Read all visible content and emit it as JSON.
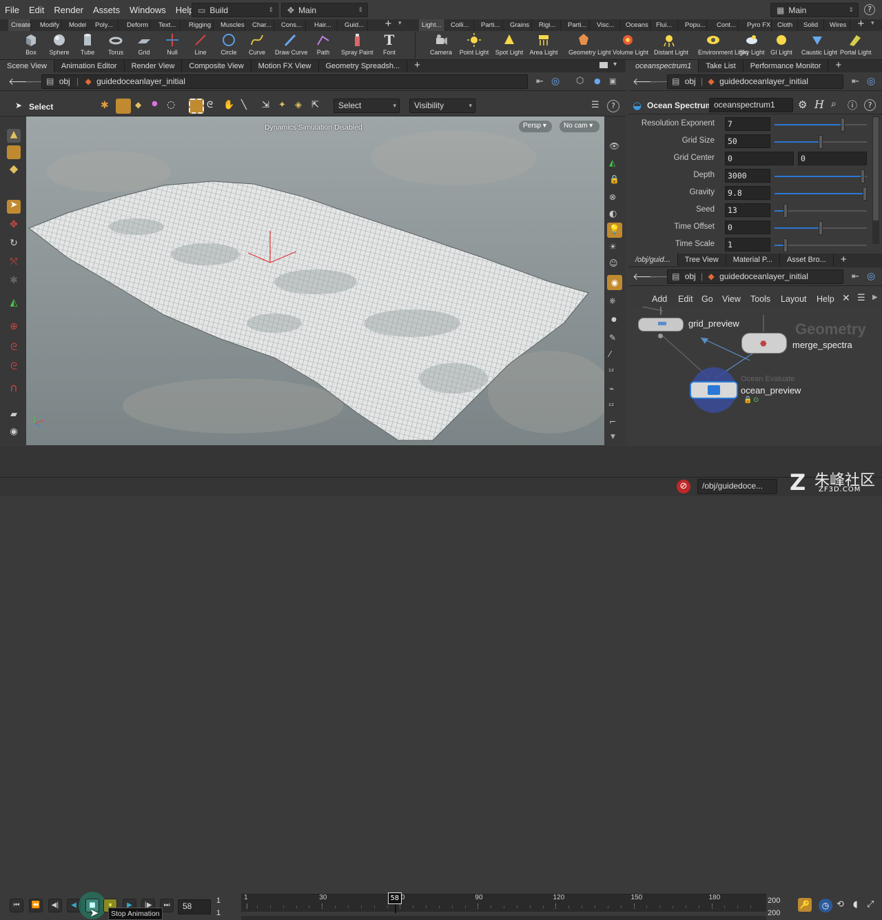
{
  "menu": [
    "File",
    "Edit",
    "Render",
    "Assets",
    "Windows",
    "Help"
  ],
  "desktop": {
    "build": "Build",
    "main": "Main",
    "top_right": "Main"
  },
  "shelf_tabs_left": [
    "Create",
    "Modify",
    "Model",
    "Poly...",
    "Deform",
    "Text...",
    "Rigging",
    "Muscles",
    "Char...",
    "Cons...",
    "Hair...",
    "Guid..."
  ],
  "shelf_tabs_right": [
    "Light...",
    "Colli...",
    "Parti...",
    "Grains",
    "Rigi...",
    "Parti...",
    "Visc...",
    "Oceans",
    "Flui...",
    "Popu...",
    "Cont...",
    "Pyro FX",
    "Cloth",
    "Solid",
    "Wires"
  ],
  "tools_left": [
    "Box",
    "Sphere",
    "Tube",
    "Torus",
    "Grid",
    "Null",
    "Line",
    "Circle",
    "Curve",
    "Draw Curve",
    "Path",
    "Spray Paint",
    "Font"
  ],
  "tools_right": [
    "Camera",
    "Point Light",
    "Spot Light",
    "Area Light",
    "Geometry Light",
    "Volume Light",
    "Distant Light",
    "Environment Light",
    "Sky Light",
    "GI Light",
    "Caustic Light",
    "Portal Light"
  ],
  "left_tabs": [
    "Scene View",
    "Animation Editor",
    "Render View",
    "Composite View",
    "Motion FX View",
    "Geometry Spreadsh..."
  ],
  "right_top_tabs": [
    "oceanspectrum1",
    "Take List",
    "Performance Monitor"
  ],
  "right_bottom_tabs": [
    "/obj/guid...",
    "Tree View",
    "Material P...",
    "Asset Bro..."
  ],
  "path": {
    "obj": "obj",
    "node": "guidedoceanlayer_initial"
  },
  "viewport_toolbar": {
    "select": "Select",
    "select_dd": "Select",
    "visibility": "Visibility"
  },
  "viewport": {
    "message": "Dynamics Simulation Disabled",
    "persp": "Persp",
    "cam": "No cam"
  },
  "parms": {
    "type_label": "Ocean Spectrum",
    "node_name": "oceanspectrum1",
    "rows": [
      {
        "label": "Resolution Exponent",
        "value": "7",
        "value2": "",
        "pct": 0.75
      },
      {
        "label": "Grid Size",
        "value": "50",
        "value2": "",
        "pct": 0.5
      },
      {
        "label": "Grid Center",
        "value": "0",
        "value2": "0",
        "pct": 0
      },
      {
        "label": "Depth",
        "value": "3000",
        "value2": "",
        "pct": 0.98
      },
      {
        "label": "Gravity",
        "value": "9.8",
        "value2": "",
        "pct": 1.0
      },
      {
        "label": "Seed",
        "value": "13",
        "value2": "",
        "pct": 0.1
      },
      {
        "label": "Time Offset",
        "value": "0",
        "value2": "",
        "pct": 0.5
      },
      {
        "label": "Time Scale",
        "value": "1",
        "value2": "",
        "pct": 0.1
      }
    ]
  },
  "network_menu": [
    "Add",
    "Edit",
    "Go",
    "View",
    "Tools",
    "Layout",
    "Help"
  ],
  "network": {
    "context": "Geometry",
    "nodes": {
      "grid_preview": "grid_preview",
      "merge_spectra": "merge_spectra",
      "ocean_preview": "ocean_preview",
      "ocean_type": "Ocean Evaluate"
    }
  },
  "timeline": {
    "current_frame": "58",
    "start": "1",
    "start2": "1",
    "end": "200",
    "end2": "200",
    "ticks": [
      "1",
      "30",
      "60",
      "90",
      "120",
      "150",
      "180"
    ],
    "tooltip": "Stop Animation"
  },
  "status": {
    "path": "/obj/guidedoce...",
    "watermark": "朱峰社区",
    "watermark_url": "ZF3D.COM"
  }
}
